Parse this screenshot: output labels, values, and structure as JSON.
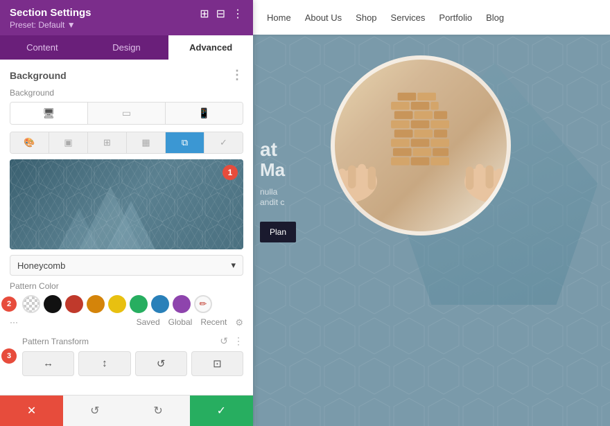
{
  "panel": {
    "header": {
      "title": "Section Settings",
      "preset": "Preset: Default ▼",
      "icons": [
        "⊞",
        "⊟",
        "⋮"
      ]
    },
    "tabs": [
      {
        "label": "Content",
        "active": false
      },
      {
        "label": "Design",
        "active": false
      },
      {
        "label": "Advanced",
        "active": true
      }
    ],
    "background_section": {
      "title": "Background",
      "more_icon": "⋮"
    },
    "background_label": "Background",
    "device_buttons": [
      {
        "icon": "🖥",
        "active": true
      },
      {
        "icon": "▭",
        "active": false
      },
      {
        "icon": "📱",
        "active": false
      }
    ],
    "bg_type_buttons": [
      {
        "icon": "🎨",
        "active": false
      },
      {
        "icon": "▣",
        "active": false
      },
      {
        "icon": "⊞",
        "active": false
      },
      {
        "icon": "▦",
        "active": false
      },
      {
        "icon": "⧉",
        "active": true
      },
      {
        "icon": "✓",
        "active": false
      }
    ],
    "badge_1": "1",
    "dropdown_value": "Honeycomb",
    "pattern_color_label": "Pattern Color",
    "badge_2": "2",
    "swatches": [
      {
        "type": "checkered"
      },
      {
        "color": "#111111"
      },
      {
        "color": "#c0392b"
      },
      {
        "color": "#d4840a"
      },
      {
        "color": "#e8c010"
      },
      {
        "color": "#27ae60"
      },
      {
        "color": "#2980b9"
      },
      {
        "color": "#8e44ad"
      },
      {
        "type": "pen"
      }
    ],
    "color_footer": {
      "dots": "···",
      "saved": "Saved",
      "global": "Global",
      "recent": "Recent",
      "settings_icon": "⚙"
    },
    "pattern_transform_label": "Pattern Transform",
    "badge_3": "3",
    "transform_icons": [
      "↺",
      "⋮"
    ],
    "transform_buttons": [
      {
        "icon": "↔",
        "label": "flip-h",
        "active": false
      },
      {
        "icon": "↕",
        "label": "flip-v",
        "active": false
      },
      {
        "icon": "↺",
        "label": "rotate",
        "active": false
      },
      {
        "icon": "⊡",
        "label": "scale",
        "active": false
      }
    ]
  },
  "footer": {
    "cancel_icon": "✕",
    "reset_icon": "↺",
    "redo_icon": "↻",
    "confirm_icon": "✓"
  },
  "navbar": {
    "items": [
      "Home",
      "About Us",
      "Shop",
      "Services",
      "Portfolio",
      "Blog"
    ]
  },
  "hero": {
    "line1": "at",
    "line2": "Ma",
    "line3": "nulla",
    "line4": "andit c",
    "plan_btn": "Plan"
  }
}
